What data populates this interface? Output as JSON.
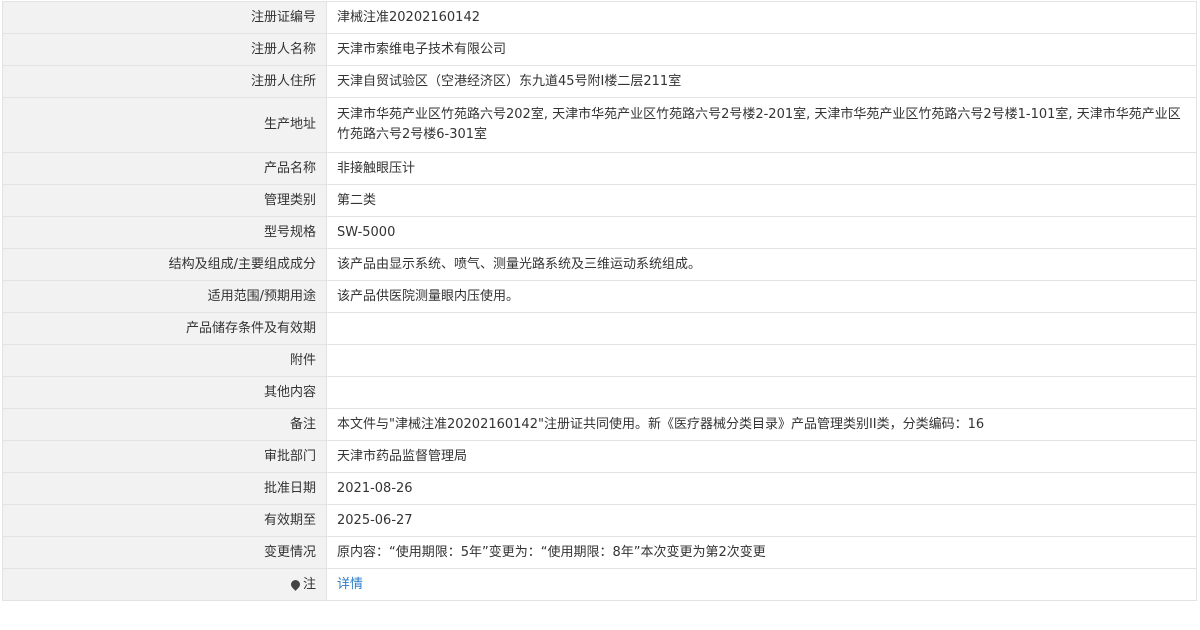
{
  "rows": [
    {
      "label": "注册证编号",
      "value": "津械注准20202160142"
    },
    {
      "label": "注册人名称",
      "value": "天津市索维电子技术有限公司"
    },
    {
      "label": "注册人住所",
      "value": "天津自贸试验区（空港经济区）东九道45号附I楼二层211室"
    },
    {
      "label": "生产地址",
      "value": "天津市华苑产业区竹苑路六号202室, 天津市华苑产业区竹苑路六号2号楼2-201室, 天津市华苑产业区竹苑路六号2号楼1-101室, 天津市华苑产业区竹苑路六号2号楼6-301室"
    },
    {
      "label": "产品名称",
      "value": "非接触眼压计"
    },
    {
      "label": "管理类别",
      "value": "第二类"
    },
    {
      "label": "型号规格",
      "value": "SW-5000"
    },
    {
      "label": "结构及组成/主要组成成分",
      "value": "该产品由显示系统、喷气、测量光路系统及三维运动系统组成。"
    },
    {
      "label": "适用范围/预期用途",
      "value": "该产品供医院测量眼内压使用。"
    },
    {
      "label": "产品储存条件及有效期",
      "value": ""
    },
    {
      "label": "附件",
      "value": ""
    },
    {
      "label": "其他内容",
      "value": ""
    },
    {
      "label": "备注",
      "value": "本文件与\"津械注准20202160142\"注册证共同使用。新《医疗器械分类目录》产品管理类别II类，分类编码：16"
    },
    {
      "label": "审批部门",
      "value": "天津市药品监督管理局"
    },
    {
      "label": "批准日期",
      "value": "2021-08-26"
    },
    {
      "label": "有效期至",
      "value": "2025-06-27"
    },
    {
      "label": "变更情况",
      "value": "原内容：“使用期限：5年”变更为：“使用期限：8年”本次变更为第2次变更"
    }
  ],
  "note": {
    "label": "注",
    "icon": "map-pin-icon",
    "link_text": "详情"
  }
}
